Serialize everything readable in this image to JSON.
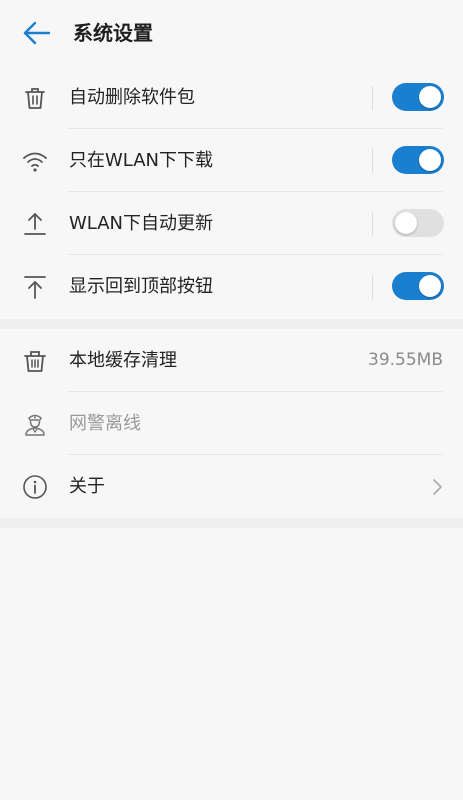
{
  "header": {
    "title": "系统设置",
    "back_icon": "back-arrow-icon"
  },
  "colors": {
    "accent": "#1a7fcf",
    "toggle_off": "#e0e0e0",
    "background": "#f7f7f7"
  },
  "settings": {
    "auto_delete": {
      "label": "自动删除软件包",
      "icon": "trash-icon",
      "enabled": true
    },
    "wlan_only_download": {
      "label": "只在WLAN下下载",
      "icon": "wifi-icon",
      "enabled": true
    },
    "wlan_auto_update": {
      "label": "WLAN下自动更新",
      "icon": "upload-icon",
      "enabled": false
    },
    "show_top_button": {
      "label": "显示回到顶部按钮",
      "icon": "to-top-icon",
      "enabled": true
    }
  },
  "misc": {
    "cache_clean": {
      "label": "本地缓存清理",
      "icon": "trash-icon",
      "value": "39.55MB"
    },
    "police_offline": {
      "label": "网警离线",
      "icon": "police-icon"
    },
    "about": {
      "label": "关于",
      "icon": "info-icon",
      "chevron": "chevron-right-icon"
    }
  }
}
